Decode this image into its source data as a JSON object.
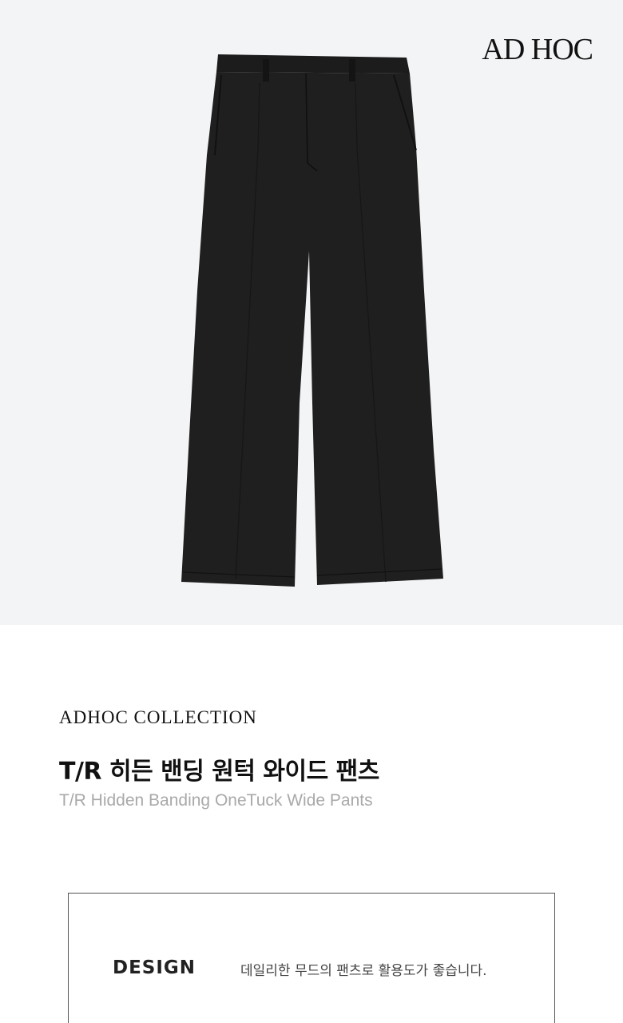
{
  "brand": {
    "logo_text": "AD HOC"
  },
  "product": {
    "collection": "ADHOC COLLECTION",
    "title_ko": "T/R 히든 밴딩 원턱 와이드 팬츠",
    "title_en": "T/R Hidden Banding OneTuck Wide Pants",
    "color": "#1e1e1f"
  },
  "details": {
    "design_label": "DESIGN",
    "design_text": "데일리한 무드의 팬츠로 활용도가 좋습니다."
  }
}
